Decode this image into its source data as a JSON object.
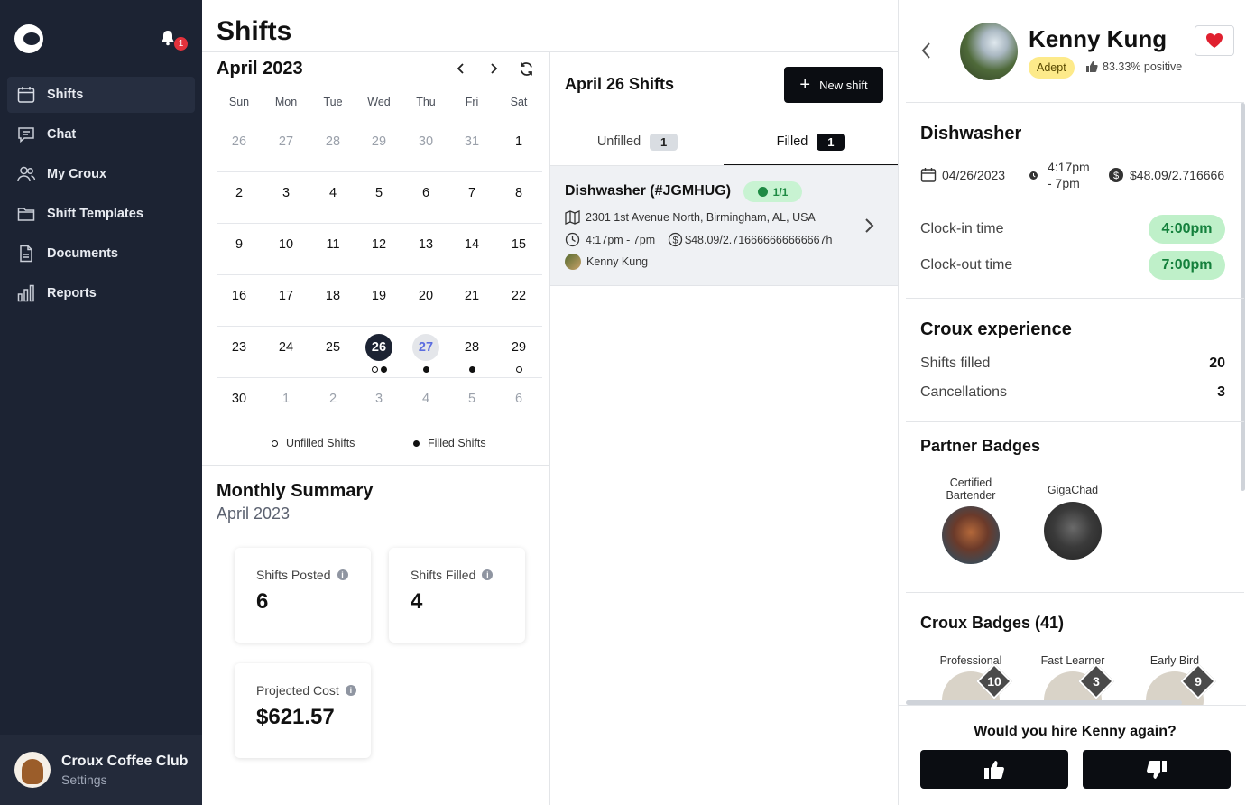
{
  "sidebar": {
    "notification_count": "1",
    "items": [
      {
        "label": "Shifts"
      },
      {
        "label": "Chat"
      },
      {
        "label": "My Croux"
      },
      {
        "label": "Shift Templates"
      },
      {
        "label": "Documents"
      },
      {
        "label": "Reports"
      }
    ],
    "footer": {
      "name": "Croux Coffee Club",
      "settings": "Settings"
    }
  },
  "page": {
    "title": "Shifts"
  },
  "calendar": {
    "month": "April 2023",
    "weekdays": [
      "Sun",
      "Mon",
      "Tue",
      "Wed",
      "Thu",
      "Fri",
      "Sat"
    ],
    "weeks": [
      [
        "26",
        "27",
        "28",
        "29",
        "30",
        "31",
        "1"
      ],
      [
        "2",
        "3",
        "4",
        "5",
        "6",
        "7",
        "8"
      ],
      [
        "9",
        "10",
        "11",
        "12",
        "13",
        "14",
        "15"
      ],
      [
        "16",
        "17",
        "18",
        "19",
        "20",
        "21",
        "22"
      ],
      [
        "23",
        "24",
        "25",
        "26",
        "27",
        "28",
        "29"
      ],
      [
        "30",
        "1",
        "2",
        "3",
        "4",
        "5",
        "6"
      ]
    ],
    "selected_day": "26",
    "today": "27",
    "legend_unfilled": "Unfilled Shifts",
    "legend_filled": "Filled Shifts"
  },
  "summary": {
    "title": "Monthly Summary",
    "subtitle": "April 2023",
    "shifts_posted_label": "Shifts Posted",
    "shifts_posted": "6",
    "shifts_filled_label": "Shifts Filled",
    "shifts_filled": "4",
    "projected_cost_label": "Projected Cost",
    "projected_cost": "$621.57",
    "info_glyph": "i"
  },
  "day_panel": {
    "title": "April 26 Shifts",
    "new_shift_label": "New shift",
    "tabs": [
      {
        "label": "Unfilled",
        "count": "1"
      },
      {
        "label": "Filled",
        "count": "1"
      }
    ],
    "shift": {
      "title": "Dishwasher (#JGMHUG)",
      "filled_badge": "1/1",
      "address": "2301 1st Avenue North, Birmingham, AL, USA",
      "time": "4:17pm - 7pm",
      "pay": "$48.09/2.716666666666667h",
      "worker": "Kenny Kung"
    }
  },
  "worker_panel": {
    "name": "Kenny Kung",
    "level": "Adept",
    "rating": "83.33% positive",
    "job": "Dishwasher",
    "date": "04/26/2023",
    "time_line1": "4:17pm",
    "time_line2": "- 7pm",
    "pay": "$48.09/2.716666",
    "clock_in_label": "Clock-in time",
    "clock_in": "4:00pm",
    "clock_out_label": "Clock-out time",
    "clock_out": "7:00pm",
    "experience_title": "Croux experience",
    "shifts_filled_label": "Shifts filled",
    "shifts_filled": "20",
    "cancellations_label": "Cancellations",
    "cancellations": "3",
    "partner_badges_title": "Partner Badges",
    "partner_badges": [
      {
        "line1": "Certified",
        "line2": "Bartender"
      },
      {
        "line1": "GigaChad",
        "line2": ""
      }
    ],
    "croux_badges_title": "Croux Badges (41)",
    "croux_badges": [
      {
        "name": "Professional",
        "count": "10"
      },
      {
        "name": "Fast Learner",
        "count": "3"
      },
      {
        "name": "Early Bird",
        "count": "9"
      }
    ],
    "hire_question": "Would you hire Kenny again?"
  },
  "colors": {
    "sidebar_bg": "#1c2333",
    "accent_green": "#bff0c9",
    "level_yellow": "#fdea8a",
    "heart_red": "#e0202f",
    "today_blue": "#5b6de0"
  }
}
